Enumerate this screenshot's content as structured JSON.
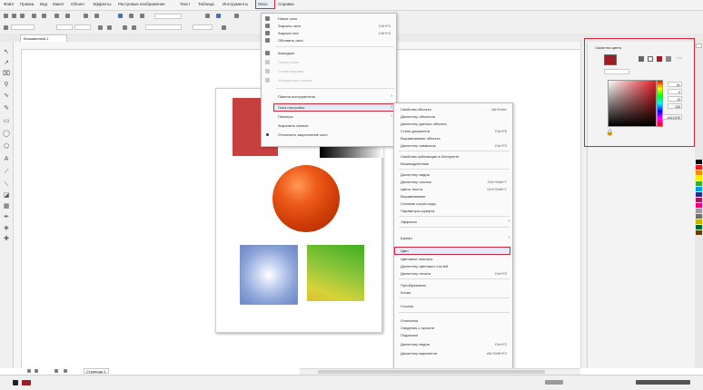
{
  "menubar": {
    "items": [
      "Файл",
      "Правка",
      "Вид",
      "Макет",
      "Объект",
      "Эффекты",
      "Растровые изображения",
      "Текст",
      "Таблица",
      "Инструменты",
      "Окно",
      "Справка"
    ]
  },
  "document_tab": {
    "label": "Безымянный-1"
  },
  "page_tab": {
    "label": "Страница 1"
  },
  "menu1": {
    "items": [
      {
        "label": "Новое окно",
        "shortcut": ""
      },
      {
        "label": "Закрыть окно",
        "shortcut": "Ctrl+F4"
      },
      {
        "label": "Закрыть все",
        "shortcut": "Ctrl+F4"
      },
      {
        "label": "Обновить окно",
        "shortcut": ""
      },
      {
        "label": "Каскадом",
        "shortcut": ""
      },
      {
        "label": "Сверху вниз",
        "shortcut": ""
      },
      {
        "label": "Слева направо",
        "shortcut": ""
      },
      {
        "label": "Упорядочить значки",
        "shortcut": ""
      },
      {
        "label": "Панели инструментов",
        "shortcut": ""
      },
      {
        "label": "Окна настройки",
        "shortcut": ""
      },
      {
        "label": "Палитры",
        "shortcut": ""
      },
      {
        "label": "Закрепить панели",
        "shortcut": ""
      },
      {
        "label": "Отключить закрепление окон",
        "shortcut": ""
      }
    ]
  },
  "menu2": {
    "items": [
      {
        "label": "Свойства объекта",
        "shortcut": "Alt+Enter"
      },
      {
        "label": "Диспетчер объектов",
        "shortcut": ""
      },
      {
        "label": "Диспетчер данных объекта",
        "shortcut": ""
      },
      {
        "label": "Стили документа",
        "shortcut": "Ctrl+F5"
      },
      {
        "label": "Выравнивание объекта",
        "shortcut": ""
      },
      {
        "label": "Диспетчер символов",
        "shortcut": "Ctrl+F3"
      },
      {
        "label": "Свойства публикации в Интернете",
        "shortcut": ""
      },
      {
        "label": "Взаимодействие",
        "shortcut": ""
      },
      {
        "label": "Диспетчер видов",
        "shortcut": ""
      },
      {
        "label": "Диспетчер ссылок",
        "shortcut": "Ctrl+Shift+T"
      },
      {
        "label": "Цвета текста",
        "shortcut": "Ctrl+Shift+Y"
      },
      {
        "label": "Выравнивание",
        "shortcut": ""
      },
      {
        "label": "Слияние штрих-кода",
        "shortcut": ""
      },
      {
        "label": "Параметры шрифта",
        "shortcut": ""
      },
      {
        "label": "Эффекты",
        "shortcut": ""
      },
      {
        "label": "Шрифт",
        "shortcut": ""
      },
      {
        "label": "Цвет",
        "shortcut": ""
      },
      {
        "label": "Цветовые палитры",
        "shortcut": ""
      },
      {
        "label": "Диспетчер цветовых стилей",
        "shortcut": ""
      },
      {
        "label": "Диспетчер печати",
        "shortcut": "Ctrl+F9"
      },
      {
        "label": "Преобразовать",
        "shortcut": ""
      },
      {
        "label": "Копия",
        "shortcut": ""
      },
      {
        "label": "Ссылки",
        "shortcut": ""
      },
      {
        "label": "Отпечатки",
        "shortcut": ""
      },
      {
        "label": "Сведения о проекте",
        "shortcut": ""
      },
      {
        "label": "Подсказки",
        "shortcut": ""
      },
      {
        "label": "Диспетчер видов",
        "shortcut": "Ctrl+F2"
      },
      {
        "label": "Диспетчер вариантов",
        "shortcut": "Alt+Shift+F2"
      }
    ]
  },
  "docker": {
    "title": "Свойства цвета",
    "values": [
      "81",
      "9",
      "13",
      "255",
      "#A11D25"
    ]
  },
  "colors": {
    "accent_red": "#d3263a",
    "swatch": "#a11d25",
    "shape_red": "#c64040"
  }
}
